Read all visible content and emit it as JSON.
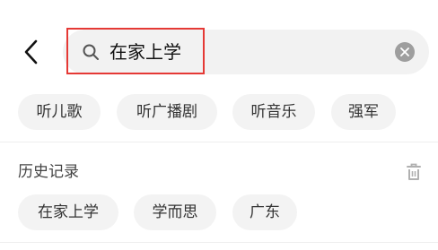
{
  "search": {
    "query": "在家上学"
  },
  "icons": {
    "back": "chevron-left-icon",
    "search": "search-icon",
    "clear": "clear-icon",
    "trash": "trash-icon"
  },
  "suggestions": [
    {
      "label": "听儿歌"
    },
    {
      "label": "听广播剧"
    },
    {
      "label": "听音乐"
    },
    {
      "label": "强军"
    }
  ],
  "history": {
    "title": "历史记录",
    "items": [
      {
        "label": "在家上学"
      },
      {
        "label": "学而思"
      },
      {
        "label": "广东"
      }
    ]
  },
  "colors": {
    "highlight_border": "#e53935",
    "search_bg": "#f2f2f2",
    "chip_bg": "#f3f3f3"
  }
}
